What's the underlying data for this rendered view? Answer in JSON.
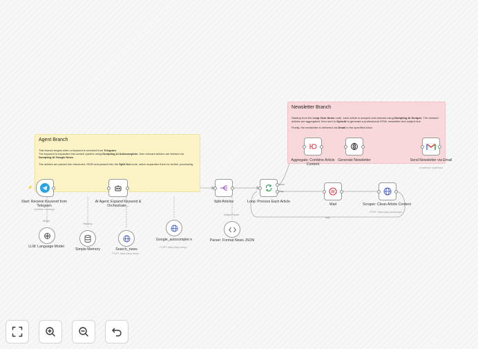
{
  "stickies": {
    "agent": {
      "title": "Agent Branch",
      "l1a": "This branch begins when a keyword is received from ",
      "l1b": "Telegram",
      "l1c": ".",
      "l2a": "The keyword is expanded into search queries using ",
      "l2b": "Dumpling AI Autocomplete",
      "l2c": ", then relevant articles are fetched via ",
      "l2d": "Dumpling AI Google News",
      "l2e": ".",
      "l3a": "The articles are parsed into structured JSON and passed into the ",
      "l3b": "Split Out",
      "l3c": " node, which separates them for further processing."
    },
    "newsletter": {
      "title": "Newsletter Branch",
      "l1a": "Starting from the ",
      "l1b": "Loop Over Items",
      "l1c": " node, each article is scraped and cleaned using ",
      "l1d": "Dumpling AI Scraper",
      "l1e": ". The cleaned articles are aggregated, then sent to ",
      "l1f": "OpenAI",
      "l1g": " to generate a professional HTML newsletter and subject line.",
      "l2a": "Finally, the newsletter is delivered via ",
      "l2b": "Gmail",
      "l2c": " to the specified inbox."
    }
  },
  "nodes": {
    "start": {
      "label": "Start: Receive Keyword from Telegram",
      "sub": "Updates: message",
      "icon": "telegram-icon"
    },
    "agent": {
      "label": "AI Agent: Expand Keyword & Orchestrate...",
      "icon": "robot-icon"
    },
    "split": {
      "label": "Split Articles",
      "icon": "split-icon"
    },
    "loop": {
      "label": "Loop: Process Each Article",
      "icon": "loop-icon"
    },
    "wait": {
      "label": "Wait",
      "icon": "pause-icon"
    },
    "scraper": {
      "label": "Scraper: Clean Article Content",
      "sub": "POST: https://app.dumplingai...",
      "icon": "globe-icon"
    },
    "aggregate": {
      "label": "Aggregate: Combine Article Content",
      "icon": "aggregate-icon"
    },
    "generate": {
      "label": "Generate Newsletter",
      "icon": "openai-icon"
    },
    "gmail": {
      "label": "Send Newsletter via Email",
      "sub": "undefined: undefined",
      "icon": "gmail-icon"
    },
    "llm": {
      "label": "LLM: Language Model",
      "tag": "Model",
      "icon": "brain-icon"
    },
    "memory": {
      "label": "Simple Memory",
      "tag": "Memory",
      "icon": "database-icon"
    },
    "news": {
      "label": "Search_news",
      "sub": "POST: https://app.dump...",
      "icon": "globe-icon"
    },
    "autocomplete": {
      "label": "Google_autocomplet e",
      "sub": "POST: https://app.dump...",
      "icon": "globe-icon"
    },
    "parser": {
      "label": "Parser: Format News JSON",
      "tag": "Output Parser",
      "icon": "code-icon"
    }
  },
  "edges": {
    "done": "done",
    "loop": "loop",
    "bottom": "loop"
  },
  "controls": {
    "fit": "fit-view-icon",
    "zoom_in": "zoom-in-icon",
    "zoom_out": "zoom-out-icon",
    "undo": "undo-icon"
  },
  "colors": {
    "accent": "#ff6d5a",
    "telegram": "#2aa3df",
    "wait": "#e0313e",
    "globe": "#3b55c4",
    "loop": "#2c9d57",
    "split": "#8c4fc4"
  }
}
